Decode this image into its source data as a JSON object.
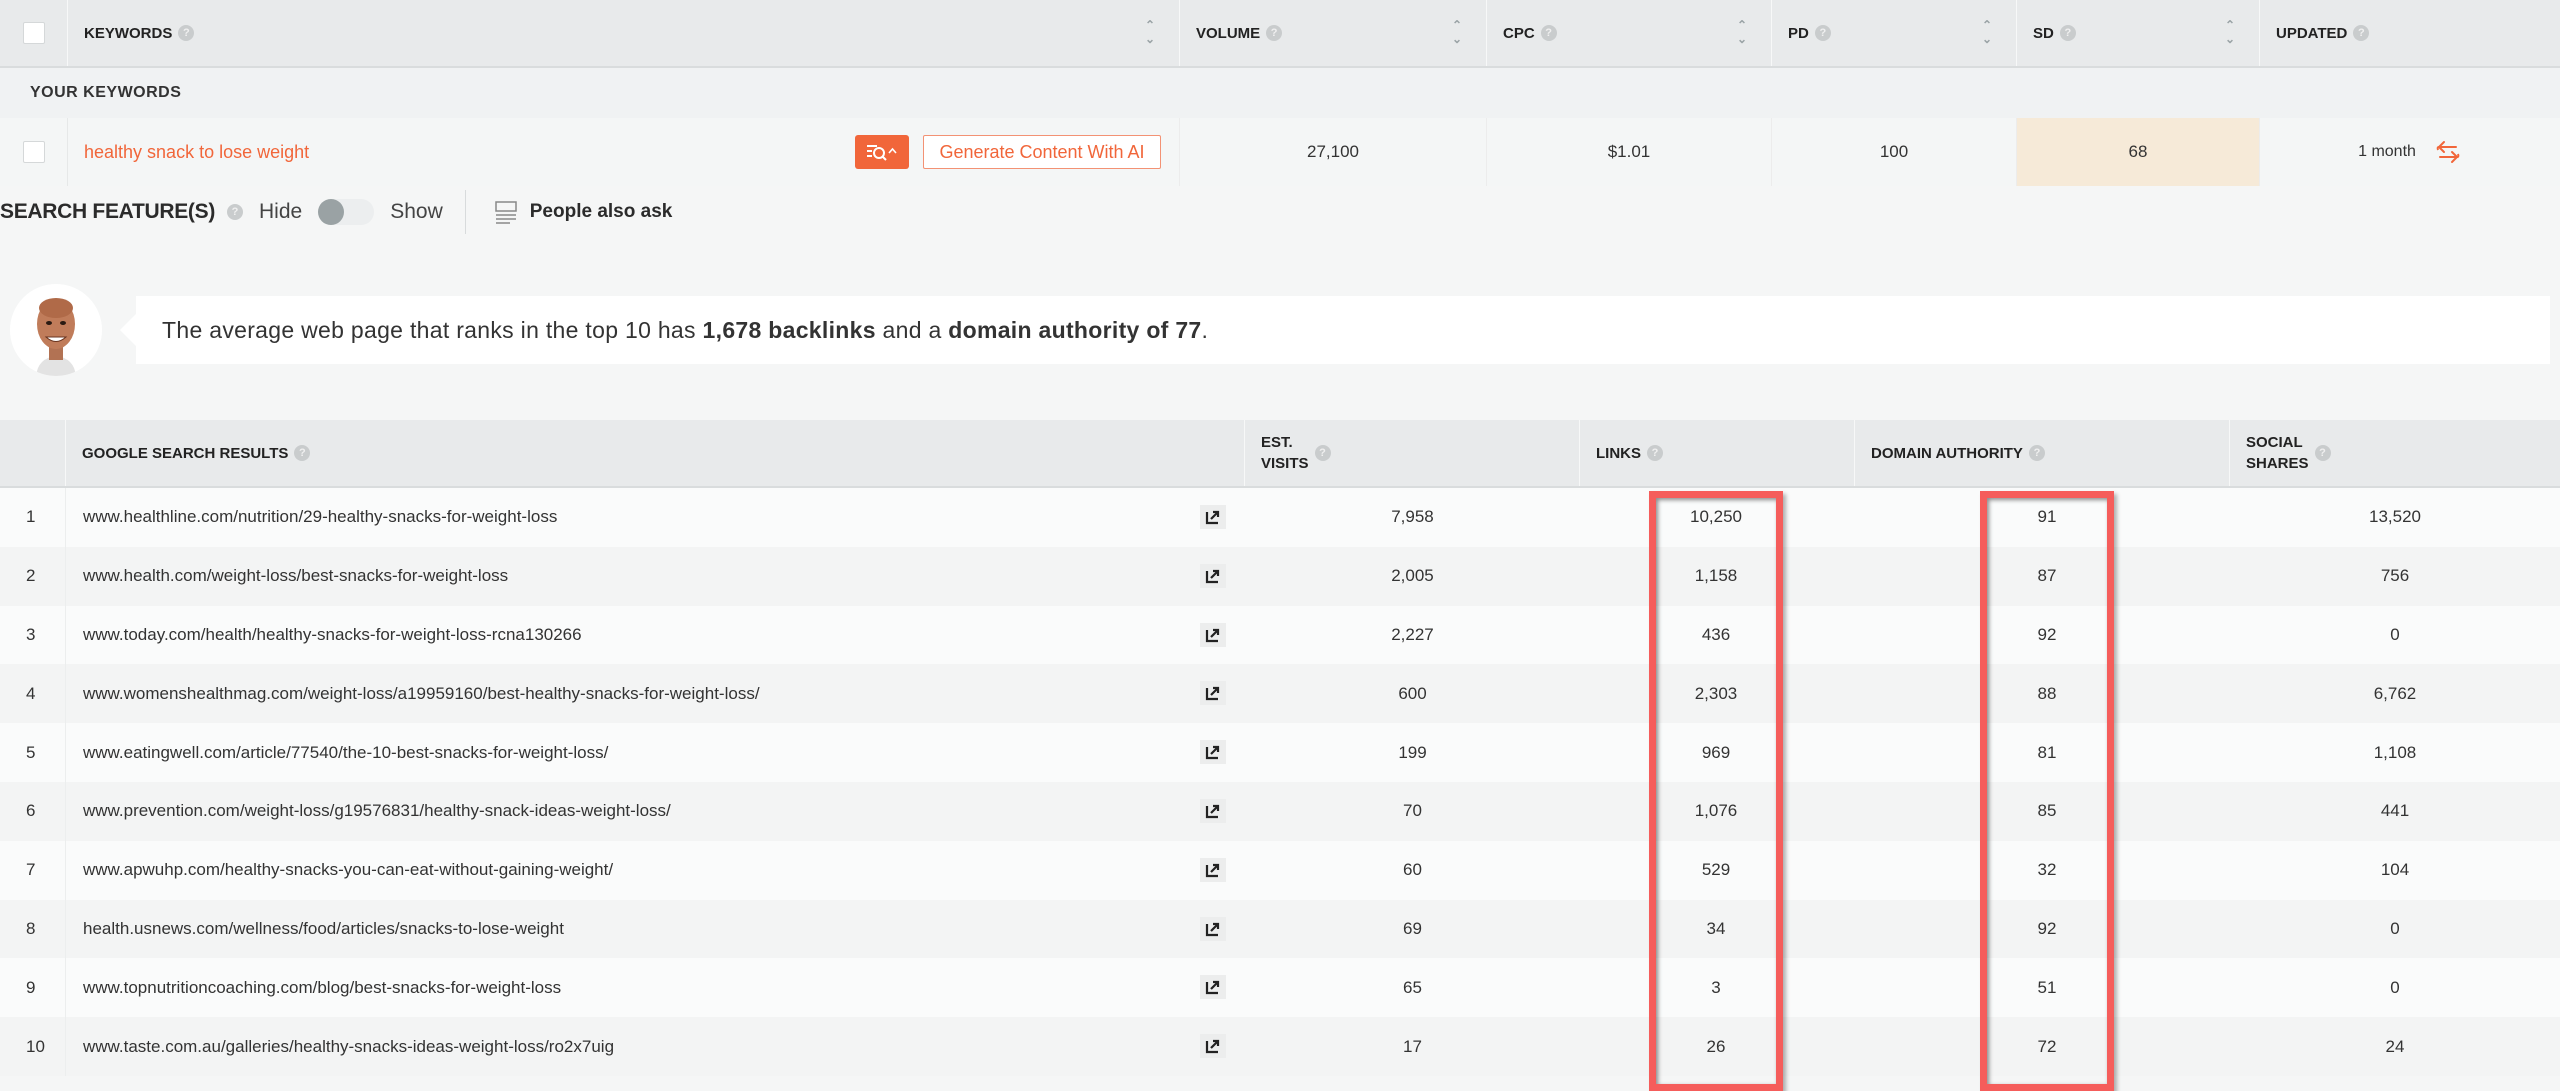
{
  "keywords_table": {
    "headers": [
      {
        "label": "KEYWORDS",
        "sortable": true
      },
      {
        "label": "VOLUME",
        "sortable": true
      },
      {
        "label": "CPC",
        "sortable": true
      },
      {
        "label": "PD",
        "sortable": true
      },
      {
        "label": "SD",
        "sortable": true
      },
      {
        "label": "UPDATED",
        "sortable": false
      }
    ],
    "section_label": "YOUR KEYWORDS",
    "row": {
      "keyword": "healthy snack to lose weight",
      "generate_button": "Generate Content With AI",
      "volume": "27,100",
      "cpc": "$1.01",
      "pd": "100",
      "sd": "68",
      "updated": "1 month"
    }
  },
  "search_features": {
    "label": "SEARCH FEATURE(S)",
    "hide_label": "Hide",
    "show_label": "Show",
    "toggle_on": false,
    "feature": "People also ask"
  },
  "tip": {
    "prefix": "The average web page that ranks in the top 10 has ",
    "backlinks": "1,678 backlinks",
    "middle": " and a ",
    "authority": "domain authority of 77",
    "suffix": "."
  },
  "results_table": {
    "headers": {
      "results": "GOOGLE SEARCH RESULTS",
      "visits_line1": "EST.",
      "visits_line2": "VISITS",
      "links": "LINKS",
      "domain_authority": "DOMAIN AUTHORITY",
      "shares_line1": "SOCIAL",
      "shares_line2": "SHARES"
    },
    "rows": [
      {
        "rank": "1",
        "url": "www.healthline.com/nutrition/29-healthy-snacks-for-weight-loss",
        "visits": "7,958",
        "links": "10,250",
        "da": "91",
        "shares": "13,520"
      },
      {
        "rank": "2",
        "url": "www.health.com/weight-loss/best-snacks-for-weight-loss",
        "visits": "2,005",
        "links": "1,158",
        "da": "87",
        "shares": "756"
      },
      {
        "rank": "3",
        "url": "www.today.com/health/healthy-snacks-for-weight-loss-rcna130266",
        "visits": "2,227",
        "links": "436",
        "da": "92",
        "shares": "0"
      },
      {
        "rank": "4",
        "url": "www.womenshealthmag.com/weight-loss/a19959160/best-healthy-snacks-for-weight-loss/",
        "visits": "600",
        "links": "2,303",
        "da": "88",
        "shares": "6,762"
      },
      {
        "rank": "5",
        "url": "www.eatingwell.com/article/77540/the-10-best-snacks-for-weight-loss/",
        "visits": "199",
        "links": "969",
        "da": "81",
        "shares": "1,108"
      },
      {
        "rank": "6",
        "url": "www.prevention.com/weight-loss/g19576831/healthy-snack-ideas-weight-loss/",
        "visits": "70",
        "links": "1,076",
        "da": "85",
        "shares": "441"
      },
      {
        "rank": "7",
        "url": "www.apwuhp.com/healthy-snacks-you-can-eat-without-gaining-weight/",
        "visits": "60",
        "links": "529",
        "da": "32",
        "shares": "104"
      },
      {
        "rank": "8",
        "url": "health.usnews.com/wellness/food/articles/snacks-to-lose-weight",
        "visits": "69",
        "links": "34",
        "da": "92",
        "shares": "0"
      },
      {
        "rank": "9",
        "url": "www.topnutritioncoaching.com/blog/best-snacks-for-weight-loss",
        "visits": "65",
        "links": "3",
        "da": "51",
        "shares": "0"
      },
      {
        "rank": "10",
        "url": "www.taste.com.au/galleries/healthy-snacks-ideas-weight-loss/ro2x7uig",
        "visits": "17",
        "links": "26",
        "da": "72",
        "shares": "24"
      }
    ]
  },
  "colors": {
    "accent": "#f1663a",
    "highlight_box": "#f55d5b",
    "sd_cell": "#f6ead8"
  }
}
